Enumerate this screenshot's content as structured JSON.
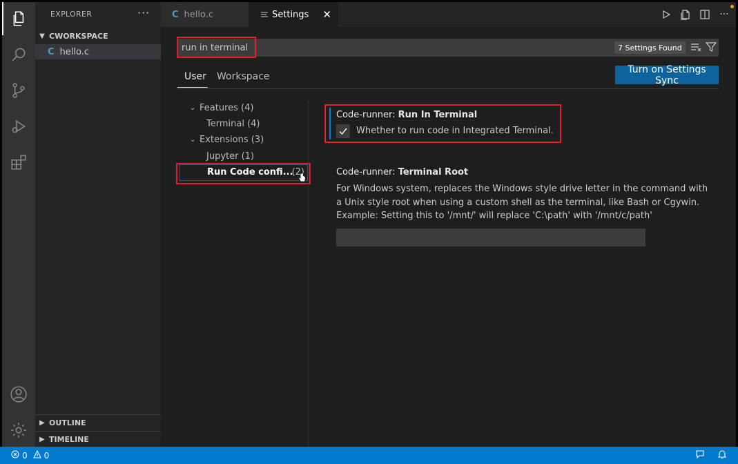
{
  "sidebar": {
    "title": "EXPLORER",
    "more": "···",
    "workspace": "CWORKSPACE",
    "file": {
      "icon_letter": "C",
      "name": "hello.c"
    },
    "outline": "OUTLINE",
    "timeline": "TIMELINE"
  },
  "tabs": [
    {
      "icon_letter": "C",
      "label": "hello.c"
    },
    {
      "icon": "settings-lines-icon",
      "label": "Settings",
      "close": "✕"
    }
  ],
  "search": {
    "value": "run in terminal",
    "result_count": "7 Settings Found"
  },
  "scope_tabs": {
    "user": "User",
    "workspace": "Workspace"
  },
  "sync_button": "Turn on Settings Sync",
  "toc": {
    "features": "Features (4)",
    "terminal": "Terminal (4)",
    "extensions": "Extensions (3)",
    "jupyter": "Jupyter (1)",
    "run_code": "Run Code confi...",
    "run_code_count": "(2)"
  },
  "settings": [
    {
      "category": "Code-runner: ",
      "name": "Run In Terminal",
      "checkbox_checked": true,
      "description": "Whether to run code in Integrated Terminal."
    },
    {
      "category": "Code-runner: ",
      "name": "Terminal Root",
      "description_lines": [
        "For Windows system, replaces the Windows style drive letter in the command with",
        "a Unix style root when using a custom shell as the terminal, like Bash or Cgywin.",
        "Example: Setting this to '/mnt/' will replace 'C:\\path' with '/mnt/c/path'"
      ],
      "value": ""
    }
  ],
  "status": {
    "errors": "0",
    "warnings": "0"
  },
  "colors": {
    "accent": "#007acc",
    "highlight_box": "#e0202a",
    "sync_button": "#0e639c"
  }
}
